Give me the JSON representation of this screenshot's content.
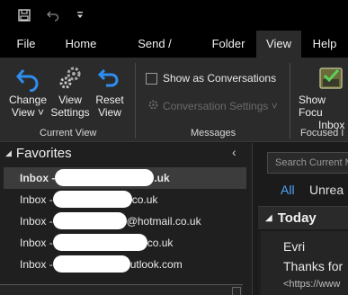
{
  "quick_access": {
    "save_icon": "save-icon",
    "undo_icon": "undo-icon",
    "customize_icon": "customize-quick-access-icon"
  },
  "tabs": [
    {
      "label": "File"
    },
    {
      "label": "Home"
    },
    {
      "label": "Send / Receive"
    },
    {
      "label": "Folder"
    },
    {
      "label": "View",
      "active": true
    },
    {
      "label": "Help"
    }
  ],
  "ribbon": {
    "change_view": {
      "line1": "Change",
      "line2": "View ˅"
    },
    "view_settings": {
      "line1": "View",
      "line2": "Settings"
    },
    "reset_view": {
      "line1": "Reset",
      "line2": "View"
    },
    "current_view_group": "Current View",
    "show_as_conversations": "Show as Conversations",
    "show_as_conversations_checked": false,
    "conversation_settings": "Conversation Settings ˅",
    "messages_group": "Messages",
    "show_focused_inbox": {
      "line1": "Show Focu",
      "line2": "Inbox"
    },
    "focused_inbox_group": "Focused I"
  },
  "favorites": {
    "header": "Favorites",
    "collapse_glyph": "‹",
    "folders": [
      {
        "prefix": "Inbox - ",
        "suffix": ".uk"
      },
      {
        "prefix": "Inbox - ",
        "suffix": "co.uk"
      },
      {
        "prefix": "Inbox - ",
        "suffix": "@hotmail.co.uk"
      },
      {
        "prefix": "Inbox - ",
        "suffix": "co.uk"
      },
      {
        "prefix": "Inbox - ",
        "suffix": "utlook.com"
      }
    ]
  },
  "mail_list": {
    "search_placeholder": "Search Current M",
    "filter_all": "All",
    "filter_unread": "Unrea",
    "group_today": "Today",
    "message": {
      "sender": "Evri",
      "subject": "Thanks for",
      "preview": "<https://www"
    }
  },
  "colors": {
    "accent": "#4fa3f7",
    "icon_blue": "#2e8ef0",
    "background": "#1b1b1b",
    "ribbon": "#2b2b2b"
  }
}
